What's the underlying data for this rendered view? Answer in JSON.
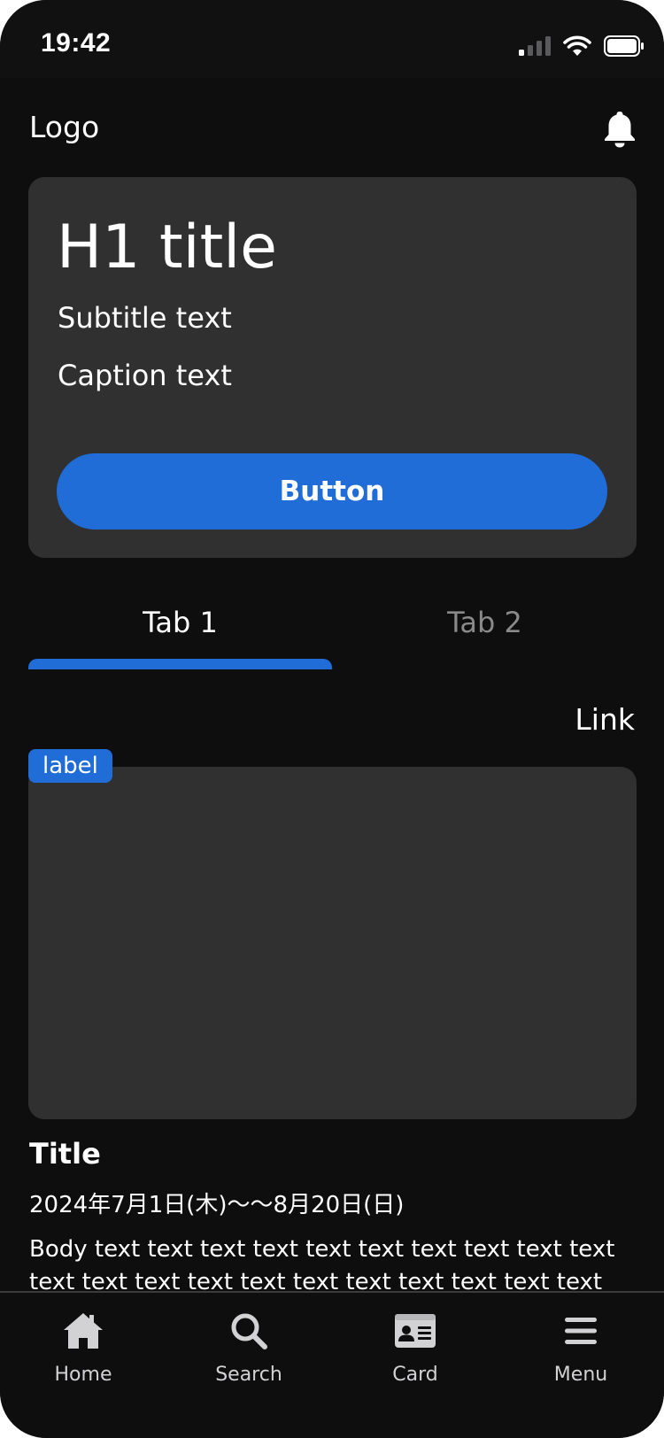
{
  "status_bar": {
    "time": "19:42"
  },
  "header": {
    "logo": "Logo"
  },
  "hero": {
    "title": "H1 title",
    "subtitle": "Subtitle text",
    "caption": "Caption text",
    "button_label": "Button"
  },
  "tabs": [
    {
      "label": "Tab 1",
      "active": true
    },
    {
      "label": "Tab 2",
      "active": false
    }
  ],
  "link": "Link",
  "content_card": {
    "badge": "label",
    "title": "Title",
    "date": "2024年7月1日(木)〜〜8月20日(日)",
    "body": "Body text text text text text text text text text text text text text text text text text text text text text text text text…"
  },
  "bottom_nav": [
    {
      "label": "Home",
      "icon": "home-icon"
    },
    {
      "label": "Search",
      "icon": "search-icon"
    },
    {
      "label": "Card",
      "icon": "id-card-icon"
    },
    {
      "label": "Menu",
      "icon": "menu-icon"
    }
  ],
  "colors": {
    "background": "#0e0e0f",
    "surface": "#303031",
    "accent": "#206dd8",
    "text": "#ffffff",
    "muted_text": "#8a8a8b"
  }
}
